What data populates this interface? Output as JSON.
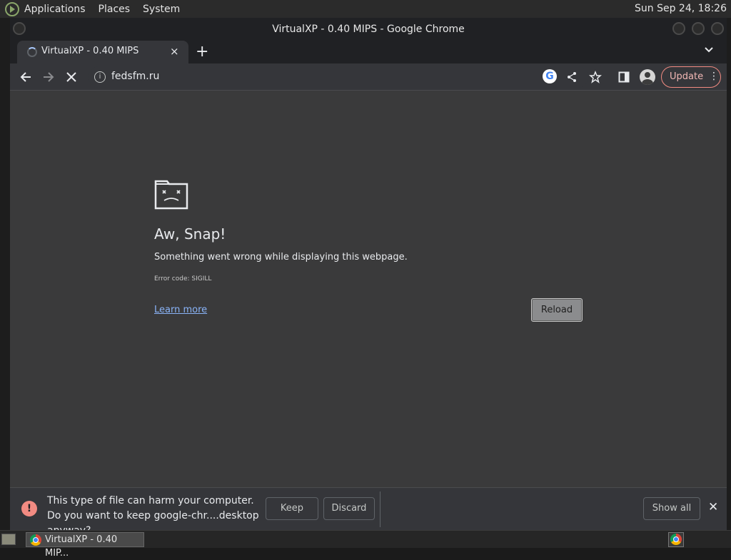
{
  "topbar": {
    "menus": [
      "Applications",
      "Places",
      "System"
    ],
    "clock": "Sun Sep 24, 18:26"
  },
  "window": {
    "title": "VirtualXP - 0.40 MIPS - Google Chrome"
  },
  "tab": {
    "title": "VirtualXP - 0.40 MIPS",
    "close": "×"
  },
  "toolbar": {
    "url": "fedsfm.ru",
    "update_label": "Update"
  },
  "error": {
    "title": "Aw, Snap!",
    "message": "Something went wrong while displaying this webpage.",
    "code": "Error code: SIGILL",
    "learn_more": "Learn more",
    "reload": "Reload"
  },
  "download": {
    "warning": "This type of file can harm your computer. Do you want to keep google-chr....desktop anyway?",
    "keep": "Keep",
    "discard": "Discard",
    "show_all": "Show all"
  },
  "taskbar": {
    "task_label": "VirtualXP - 0.40 MIP..."
  },
  "colors": {
    "accent_link": "#8ab4f8",
    "warning": "#f28b82",
    "update_border": "#f28b82",
    "page_bg": "#3a3a3b"
  },
  "icons": [
    "app-menu-icon",
    "spinner-icon",
    "close-icon",
    "plus-icon",
    "chevron-down-icon",
    "back-icon",
    "forward-icon",
    "stop-icon",
    "info-icon",
    "google-icon",
    "share-icon",
    "star-icon",
    "side-panel-icon",
    "profile-icon",
    "more-vert-icon",
    "sad-tab-icon",
    "warning-icon",
    "chrome-icon"
  ]
}
